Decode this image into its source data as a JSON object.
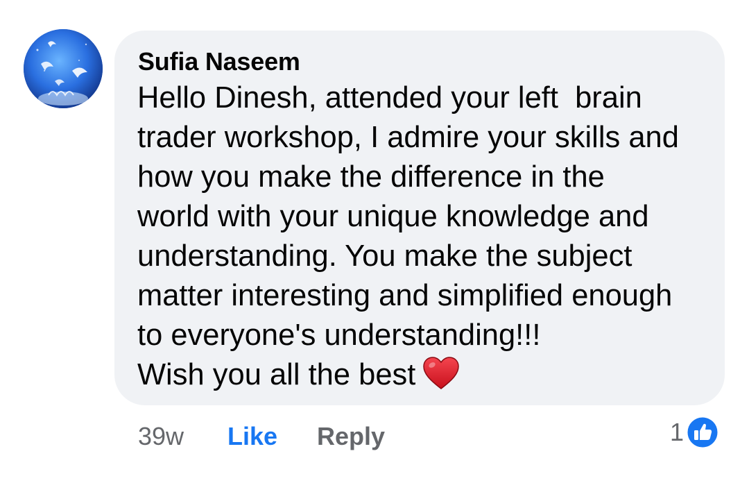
{
  "comment": {
    "author": "Sufia Naseem",
    "lines": [
      "Hello Dinesh, attended your left  brain",
      "trader workshop, I admire your skills and",
      "how you make the difference in the",
      "world with your unique knowledge and",
      "understanding. You make the subject",
      "matter interesting and simplified enough",
      "to everyone's understanding!!!",
      "Wish you all the best"
    ],
    "emoji": "red-heart-icon"
  },
  "actions": {
    "time": "39w",
    "like_label": "Like",
    "reply_label": "Reply",
    "reaction_count": "1",
    "reaction_icon": "like-reaction-icon"
  },
  "colors": {
    "bubble": "#f0f2f5",
    "link_blue": "#1877f2",
    "meta_gray": "#65676b",
    "heart_red": "#e0202c"
  }
}
